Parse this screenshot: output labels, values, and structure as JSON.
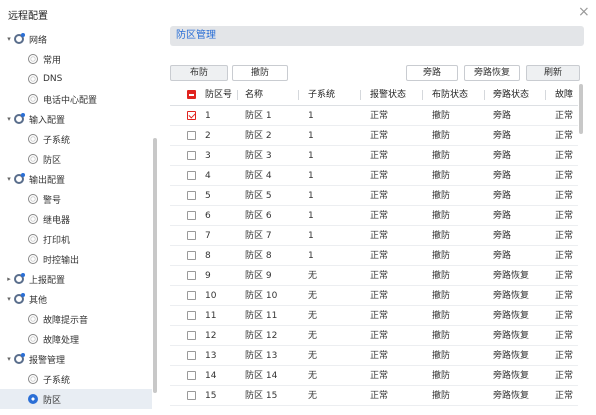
{
  "window": {
    "title": "远程配置",
    "close_glyph": "×"
  },
  "sidebar": {
    "items": [
      {
        "label": "网络",
        "level": 0,
        "expanded": true,
        "icon": "network-node-icon"
      },
      {
        "label": "常用",
        "level": 1,
        "icon": "gear-icon"
      },
      {
        "label": "DNS",
        "level": 1,
        "icon": "gear-icon"
      },
      {
        "label": "电话中心配置",
        "level": 1,
        "icon": "gear-icon"
      },
      {
        "label": "输入配置",
        "level": 0,
        "expanded": true,
        "icon": "network-node-icon"
      },
      {
        "label": "子系统",
        "level": 1,
        "icon": "gear-icon"
      },
      {
        "label": "防区",
        "level": 1,
        "icon": "gear-icon"
      },
      {
        "label": "输出配置",
        "level": 0,
        "expanded": true,
        "icon": "network-node-icon"
      },
      {
        "label": "警号",
        "level": 1,
        "icon": "gear-icon"
      },
      {
        "label": "继电器",
        "level": 1,
        "icon": "gear-icon"
      },
      {
        "label": "打印机",
        "level": 1,
        "icon": "gear-icon"
      },
      {
        "label": "时控输出",
        "level": 1,
        "icon": "gear-icon"
      },
      {
        "label": "上报配置",
        "level": 0,
        "expanded": false,
        "icon": "network-node-icon"
      },
      {
        "label": "其他",
        "level": 0,
        "expanded": true,
        "icon": "network-node-icon"
      },
      {
        "label": "故障提示音",
        "level": 1,
        "icon": "gear-icon"
      },
      {
        "label": "故障处理",
        "level": 1,
        "icon": "gear-icon"
      },
      {
        "label": "报警管理",
        "level": 0,
        "expanded": true,
        "icon": "network-node-icon"
      },
      {
        "label": "子系统",
        "level": 1,
        "icon": "gear-icon"
      },
      {
        "label": "防区",
        "level": 1,
        "icon": "gear-icon",
        "selected": true
      }
    ]
  },
  "main": {
    "section_title": "防区管理",
    "buttons": {
      "arm": "布防",
      "disarm": "撤防",
      "bypass": "旁路",
      "bypass_restore": "旁路恢复",
      "refresh": "刷新"
    },
    "columns": [
      "防区号",
      "名称",
      "子系统",
      "报警状态",
      "布防状态",
      "旁路状态",
      "故障"
    ],
    "rows": [
      {
        "checked": true,
        "no": "1",
        "name": "防区 1",
        "subsystem": "1",
        "alarm": "正常",
        "arm": "撤防",
        "bypass": "旁路",
        "fault": "正常"
      },
      {
        "checked": false,
        "no": "2",
        "name": "防区 2",
        "subsystem": "1",
        "alarm": "正常",
        "arm": "撤防",
        "bypass": "旁路",
        "fault": "正常"
      },
      {
        "checked": false,
        "no": "3",
        "name": "防区 3",
        "subsystem": "1",
        "alarm": "正常",
        "arm": "撤防",
        "bypass": "旁路",
        "fault": "正常"
      },
      {
        "checked": false,
        "no": "4",
        "name": "防区 4",
        "subsystem": "1",
        "alarm": "正常",
        "arm": "撤防",
        "bypass": "旁路",
        "fault": "正常"
      },
      {
        "checked": false,
        "no": "5",
        "name": "防区 5",
        "subsystem": "1",
        "alarm": "正常",
        "arm": "撤防",
        "bypass": "旁路",
        "fault": "正常"
      },
      {
        "checked": false,
        "no": "6",
        "name": "防区 6",
        "subsystem": "1",
        "alarm": "正常",
        "arm": "撤防",
        "bypass": "旁路",
        "fault": "正常"
      },
      {
        "checked": false,
        "no": "7",
        "name": "防区 7",
        "subsystem": "1",
        "alarm": "正常",
        "arm": "撤防",
        "bypass": "旁路",
        "fault": "正常"
      },
      {
        "checked": false,
        "no": "8",
        "name": "防区 8",
        "subsystem": "1",
        "alarm": "正常",
        "arm": "撤防",
        "bypass": "旁路",
        "fault": "正常"
      },
      {
        "checked": false,
        "no": "9",
        "name": "防区 9",
        "subsystem": "无",
        "alarm": "正常",
        "arm": "撤防",
        "bypass": "旁路恢复",
        "fault": "正常"
      },
      {
        "checked": false,
        "no": "10",
        "name": "防区 10",
        "subsystem": "无",
        "alarm": "正常",
        "arm": "撤防",
        "bypass": "旁路恢复",
        "fault": "正常"
      },
      {
        "checked": false,
        "no": "11",
        "name": "防区 11",
        "subsystem": "无",
        "alarm": "正常",
        "arm": "撤防",
        "bypass": "旁路恢复",
        "fault": "正常"
      },
      {
        "checked": false,
        "no": "12",
        "name": "防区 12",
        "subsystem": "无",
        "alarm": "正常",
        "arm": "撤防",
        "bypass": "旁路恢复",
        "fault": "正常"
      },
      {
        "checked": false,
        "no": "13",
        "name": "防区 13",
        "subsystem": "无",
        "alarm": "正常",
        "arm": "撤防",
        "bypass": "旁路恢复",
        "fault": "正常"
      },
      {
        "checked": false,
        "no": "14",
        "name": "防区 14",
        "subsystem": "无",
        "alarm": "正常",
        "arm": "撤防",
        "bypass": "旁路恢复",
        "fault": "正常"
      },
      {
        "checked": false,
        "no": "15",
        "name": "防区 15",
        "subsystem": "无",
        "alarm": "正常",
        "arm": "撤防",
        "bypass": "旁路恢复",
        "fault": "正常"
      }
    ]
  }
}
